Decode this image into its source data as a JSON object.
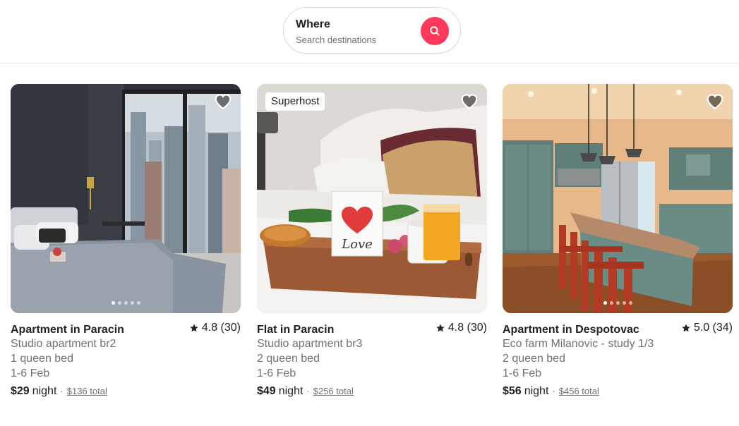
{
  "search": {
    "title": "Where",
    "placeholder": "Search destinations",
    "button_icon": "search-icon",
    "accent_color": "#ff385c"
  },
  "listings": [
    {
      "title": "Apartment in Paracin",
      "rating": "4.8 (30)",
      "subtitle": "Studio apartment br2",
      "beds": "1 queen bed",
      "dates": "1-6 Feb",
      "price": "$29",
      "per": "night",
      "separator": "·",
      "total": "$136 total",
      "badge": "",
      "photo": "bedroom-city-view",
      "dots": 5,
      "active_dot": 0
    },
    {
      "title": "Flat in Paracin",
      "rating": "4.8 (30)",
      "subtitle": "Studio apartment br3",
      "beds": "2 queen bed",
      "dates": "1-6 Feb",
      "price": "$49",
      "per": "night",
      "separator": "·",
      "total": "$256 total",
      "badge": "Superhost",
      "photo": "breakfast-tray-love-card",
      "dots": 0,
      "active_dot": 0
    },
    {
      "title": "Apartment in Despotovac",
      "rating": "5.0 (34)",
      "subtitle": "Eco farm Milanovic - study 1/3",
      "beds": "2 queen bed",
      "dates": "1-6 Feb",
      "price": "$56",
      "per": "night",
      "separator": "·",
      "total": "$456 total",
      "badge": "",
      "photo": "kitchen-island",
      "dots": 5,
      "active_dot": 0
    }
  ],
  "photo_text": {
    "love_card": "Love"
  },
  "icons": {
    "favorite": "heart-icon",
    "rating": "star-icon"
  }
}
